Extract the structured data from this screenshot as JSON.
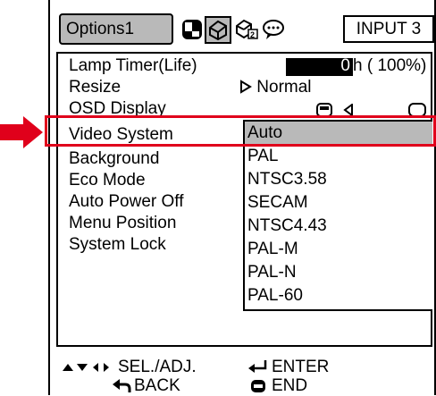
{
  "tabs": {
    "active_label": "Options1",
    "icons": [
      "picture-icon",
      "options1-icon",
      "options2-icon",
      "language-icon"
    ]
  },
  "input_label": "INPUT 3",
  "menu": {
    "lamp_timer": {
      "label": "Lamp Timer(Life)",
      "value": "0",
      "unit_text": "h ( 100%)"
    },
    "resize": {
      "label": "Resize",
      "value": "Normal"
    },
    "osd_display": {
      "label": "OSD Display"
    },
    "video_system": {
      "label": "Video System"
    },
    "items": [
      "Background",
      "Eco Mode",
      "Auto Power Off",
      "Menu Position",
      "System Lock"
    ]
  },
  "dropdown": {
    "selected": "Auto",
    "options": [
      "Auto",
      "PAL",
      "NTSC3.58",
      "SECAM",
      "NTSC4.43",
      "PAL-M",
      "PAL-N",
      "PAL-60"
    ]
  },
  "footer": {
    "sel_adj": "SEL./ADJ.",
    "enter": "ENTER",
    "back": "BACK",
    "end": "END"
  },
  "colors": {
    "highlight": "#e0001b",
    "selection_gray": "#b9b9b9"
  }
}
